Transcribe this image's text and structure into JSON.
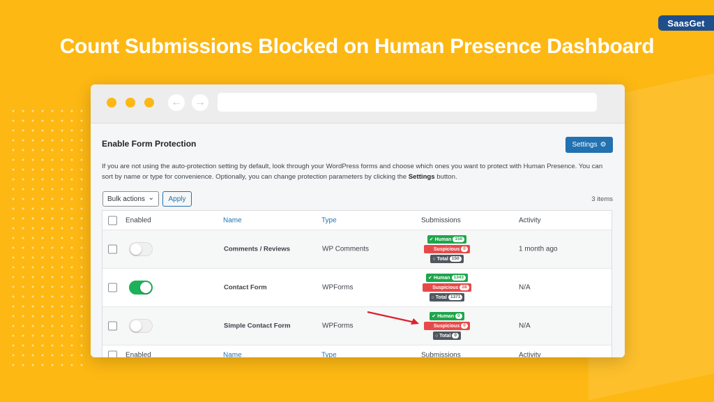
{
  "headline": "Count Submissions Blocked on Human Presence Dashboard",
  "brand": "SaasGet",
  "colors": {
    "background": "#fdb813",
    "accent": "#2271b1",
    "human": "#1ea54b",
    "suspicious": "#e64a4a",
    "total": "#50575e"
  },
  "page": {
    "title": "Enable Form Protection",
    "settings_label": "Settings",
    "description_part1": "If you are not using the auto-protection setting by default, look through your WordPress forms and choose which ones you want to protect with Human Presence. You can sort by name or type for convenience. Optionally, you can change protection parameters by clicking the ",
    "description_bold": "Settings",
    "description_part2": " button.",
    "bulk_actions": "Bulk actions",
    "apply_label": "Apply",
    "items_count": "3 items"
  },
  "table": {
    "columns": {
      "enabled": "Enabled",
      "name": "Name",
      "type": "Type",
      "submissions": "Submissions",
      "activity": "Activity"
    },
    "badge_labels": {
      "human": "Human",
      "suspicious": "Suspicious",
      "total": "Total"
    },
    "rows": [
      {
        "enabled": false,
        "name": "Comments / Reviews",
        "type": "WP Comments",
        "human": "150",
        "suspicious": "0",
        "total": "150",
        "activity": "1 month ago"
      },
      {
        "enabled": true,
        "name": "Contact Form",
        "type": "WPForms",
        "human": "1343",
        "suspicious": "28",
        "total": "1371",
        "activity": "N/A"
      },
      {
        "enabled": false,
        "name": "Simple Contact Form",
        "type": "WPForms",
        "human": "0",
        "suspicious": "0",
        "total": "0",
        "activity": "N/A"
      }
    ]
  }
}
